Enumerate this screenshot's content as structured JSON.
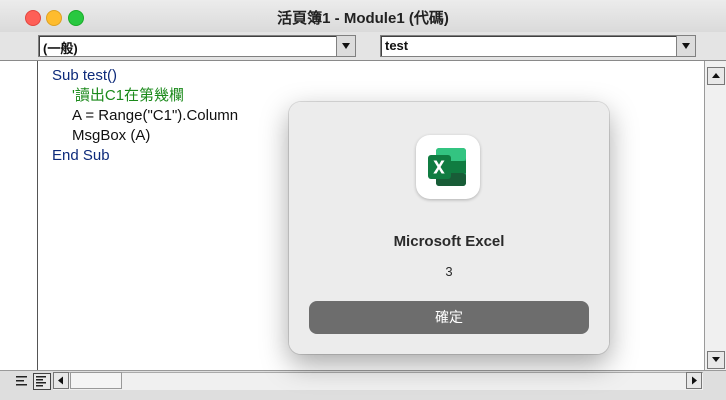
{
  "window": {
    "title": "活頁簿1 - Module1 (代碼)"
  },
  "toolbar": {
    "object_combo": "(一般)",
    "procedure_combo": "test"
  },
  "code": {
    "lines": [
      {
        "kind": "kw",
        "text": "Sub test()"
      },
      {
        "kind": "comment",
        "text": "'讀出C1在第幾欄"
      },
      {
        "kind": "plain",
        "text": "A = Range(\"C1\").Column"
      },
      {
        "kind": "plain",
        "text": "MsgBox (A)"
      },
      {
        "kind": "kw",
        "text": "End Sub"
      }
    ]
  },
  "dialog": {
    "app_name": "Microsoft Excel",
    "message": "3",
    "button_label": "確定",
    "icon": "excel-icon"
  },
  "colors": {
    "excel_green": "#1d6f42",
    "keyword": "#0d2a7a",
    "comment": "#1b8a1b"
  }
}
